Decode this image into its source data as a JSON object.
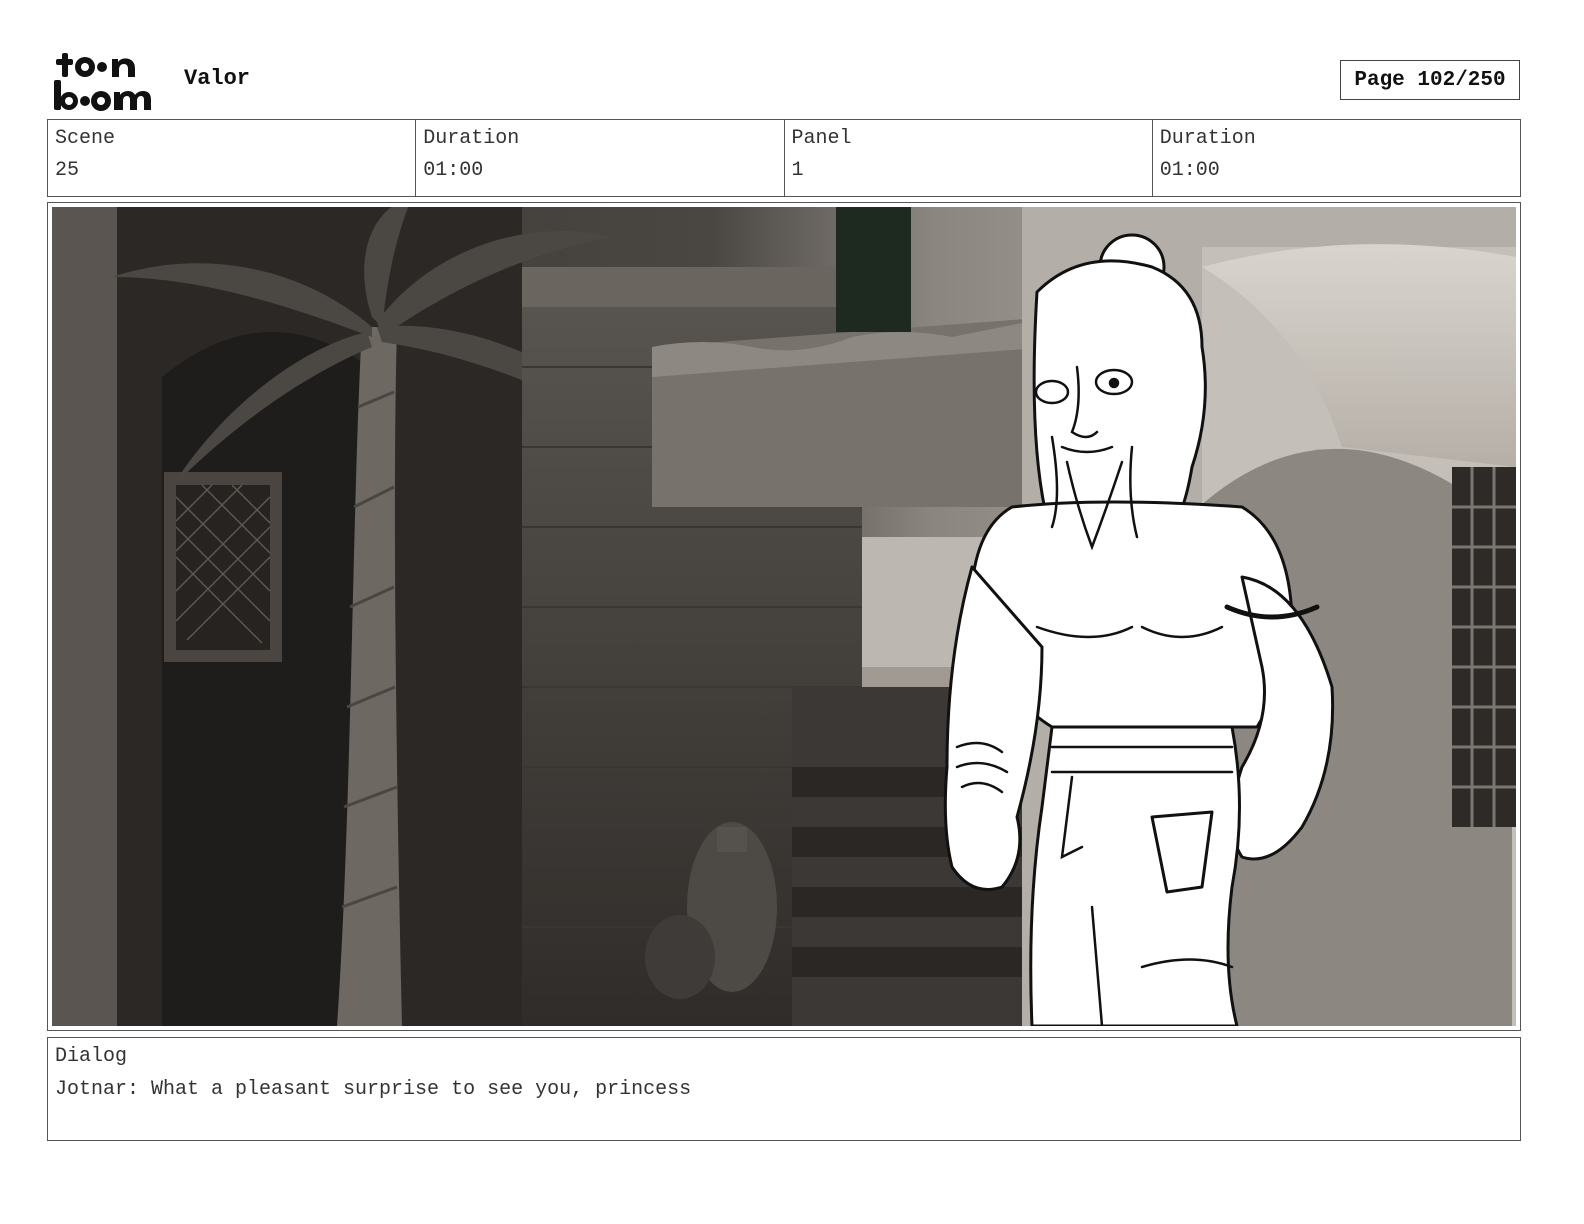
{
  "header": {
    "logo_text_top": "toon",
    "logo_text_bottom": "boom",
    "project_title": "Valor",
    "page_label": "Page 102/250"
  },
  "info": {
    "scene_label": "Scene",
    "scene_value": "25",
    "scene_duration_label": "Duration",
    "scene_duration_value": "01:00",
    "panel_label": "Panel",
    "panel_value": "1",
    "panel_duration_label": "Duration",
    "panel_duration_value": "01:00"
  },
  "panel": {
    "image_icon": "storyboard-panel-image"
  },
  "dialog": {
    "label": "Dialog",
    "text": "Jotnar: What a pleasant surprise to see you, princess"
  },
  "colors": {
    "border": "#555555",
    "text": "#333333",
    "scene_dark": "#2e2b28",
    "scene_light": "#cfcac4"
  }
}
